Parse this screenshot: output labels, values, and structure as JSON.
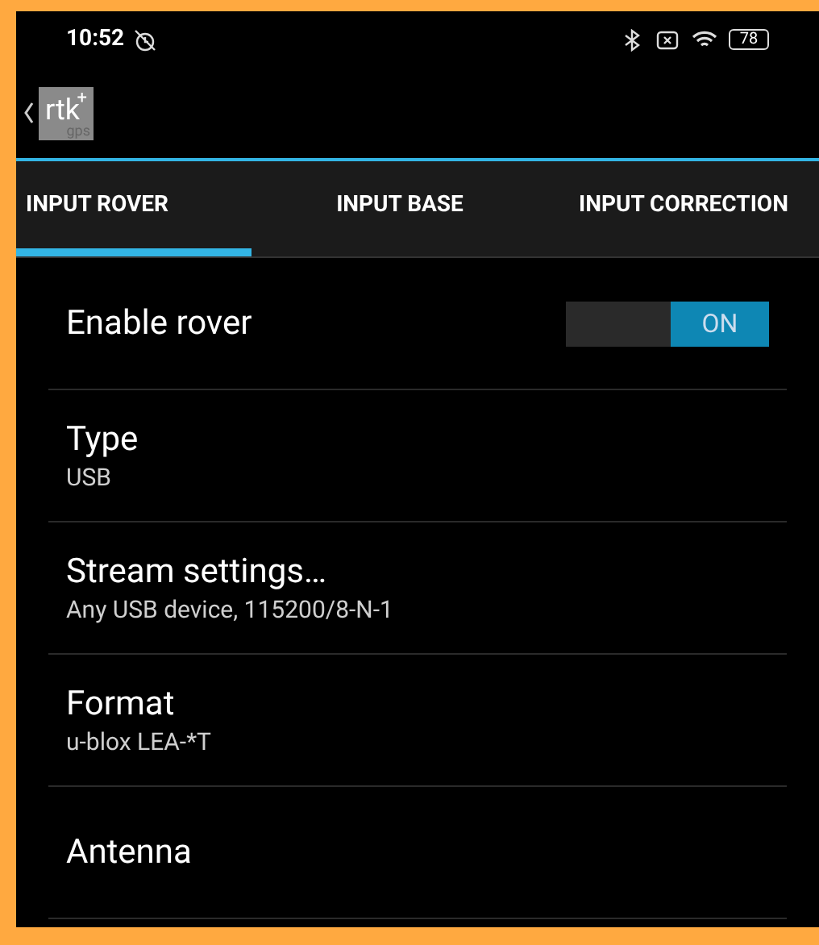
{
  "status_bar": {
    "time": "10:52",
    "battery": "78"
  },
  "app_bar": {
    "logo": {
      "main": "rtk",
      "sup": "+",
      "sub": "gps"
    }
  },
  "tabs": [
    {
      "label": "INPUT ROVER",
      "selected": true
    },
    {
      "label": "INPUT BASE",
      "selected": false
    },
    {
      "label": "INPUT CORRECTION",
      "selected": false
    }
  ],
  "settings": [
    {
      "kind": "toggle",
      "title": "Enable rover",
      "on": true,
      "switch_label": "ON"
    },
    {
      "kind": "value",
      "title": "Type",
      "summary": "USB"
    },
    {
      "kind": "value",
      "title": "Stream settings…",
      "summary": "Any USB device, 115200/8-N-1"
    },
    {
      "kind": "value",
      "title": "Format",
      "summary": "u-blox LEA-*T"
    },
    {
      "kind": "value",
      "title": "Antenna"
    }
  ]
}
